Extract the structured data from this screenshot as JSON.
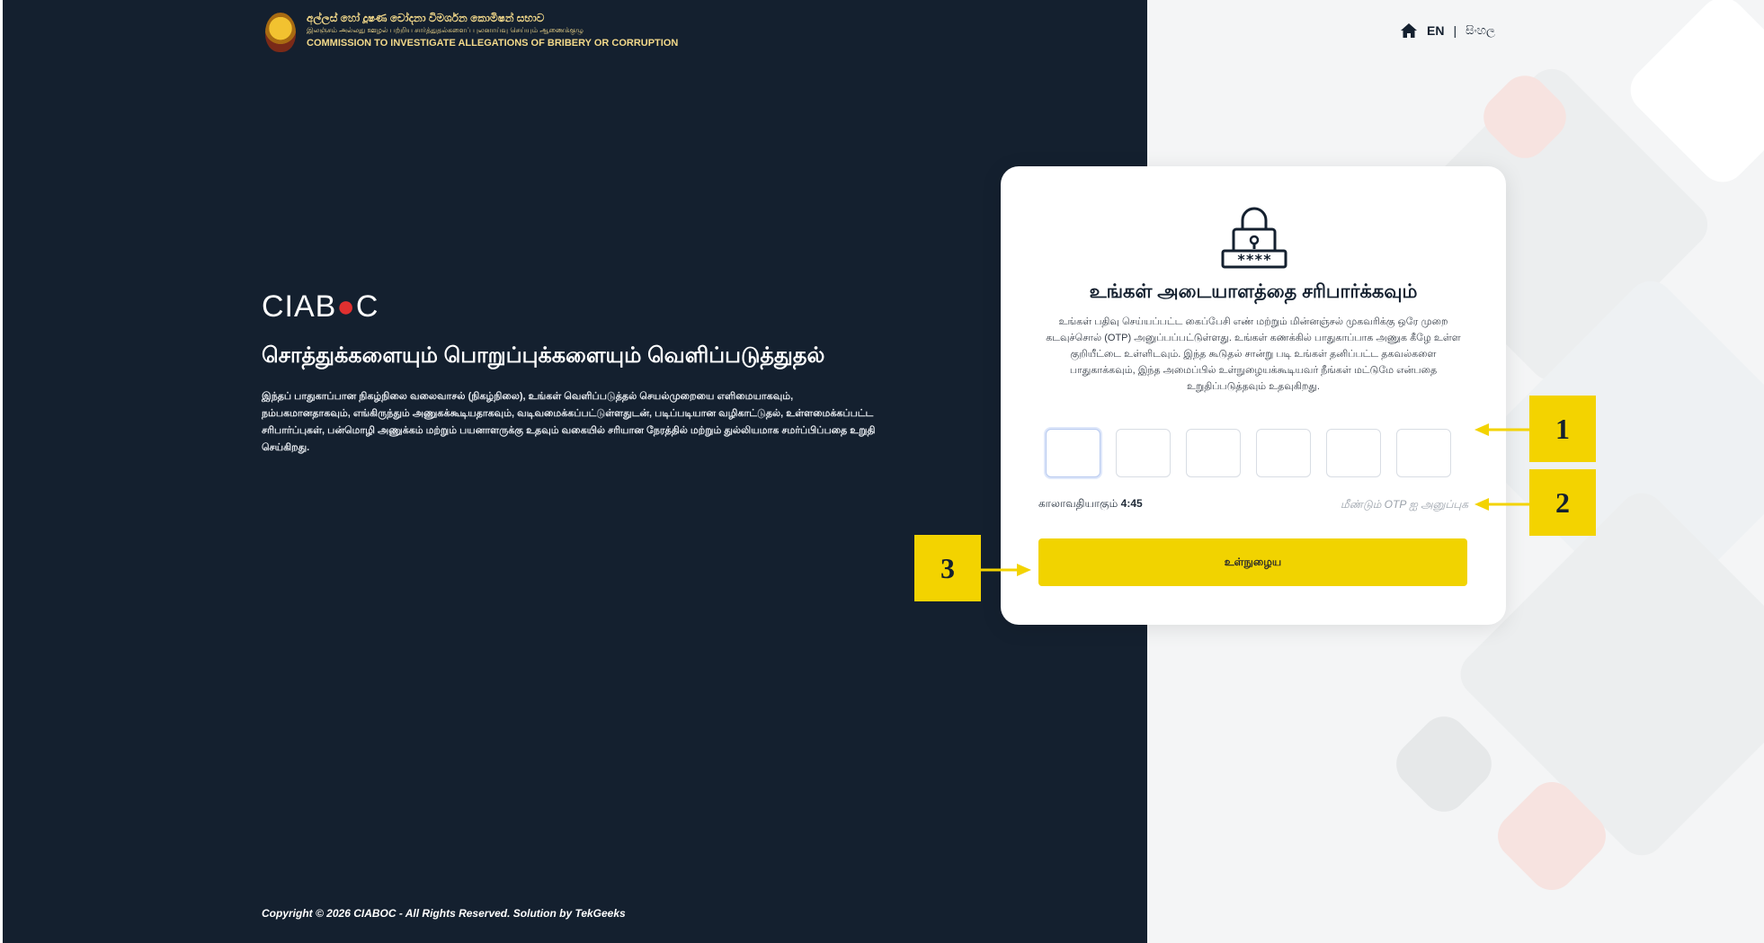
{
  "header": {
    "org_sinhala": "අල්ලස් හෝ දූෂණ චෝදනා විමර්ශන කොමිෂන් සභාව",
    "org_tamil": "இலஞ்சம் அல்லது ஊழல் பற்றிய சார்த்துதல்களைப் புலனாய்வு செய்யும் ஆணைக்குழு",
    "org_english": "COMMISSION TO INVESTIGATE ALLEGATIONS OF BRIBERY OR CORRUPTION"
  },
  "brand": {
    "logo_prefix": "CIAB",
    "logo_dot": "●",
    "logo_suffix": "C",
    "title": "சொத்துக்களையும் பொறுப்புக்களையும் வெளிப்படுத்துதல்",
    "description": "இந்தப் பாதுகாப்பான நிகழ்நிலை வலைவாசல் (நிகழ்நிலை), உங்கள் வெளிப்படுத்தல் செயல்முறையை எளிமையாகவும், நம்பகமானதாகவும், எங்கிருந்தும் அணுகக்கூடியதாகவும், வடிவமைக்கப்பட்டுள்ளதுடன், படிப்படியான வழிகாட்டுதல், உள்ளமைக்கப்பட்ட சரிபார்ப்புகள், பன்மொழி அணுக்கம் மற்றும் பயனாளருக்கு உதவும் வகையில் சரியான நேரத்தில் மற்றும் துல்லியமாக சமர்ப்பிப்பதை உறுதி செய்கிறது."
  },
  "footer": {
    "copyright": "Copyright © 2026 CIABOC - All Rights Reserved. Solution by TekGeeks"
  },
  "nav": {
    "home_icon": "home-icon",
    "lang_en": "EN",
    "separator": "|",
    "lang_si": "සිංහල"
  },
  "card": {
    "icon": "lock-password-icon",
    "title": "உங்கள் அடையாளத்தை சரிபார்க்கவும்",
    "description": "உங்கள் பதிவு செய்யப்பட்ட கைப்பேசி எண் மற்றும் மின்னஞ்சல் முகவரிக்கு ஒரே முறை கடவுச்சொல் (OTP) அனுப்பப்பட்டுள்ளது. உங்கள் கணக்கில் பாதுகாப்பாக அணுக கீழே உள்ள குறியீட்டை உள்ளிடவும். இந்த கூடுதல் சான்று படி உங்கள் தனிப்பட்ட தகவல்களை பாதுகாக்கவும், இந்த அமைப்பில் உள்நுழையக்கூடியவர் நீங்கள் மட்டுமே என்பதை உறுதிப்படுத்தவும் உதவுகிறது.",
    "otp_digits": [
      "",
      "",
      "",
      "",
      "",
      ""
    ],
    "timer_label": "காலாவதியாகும்",
    "timer_value": "4:45",
    "resend_label": "மீண்டும் OTP ஐ அனுப்புக",
    "submit_label": "உள்நுழைய"
  },
  "callouts": [
    "1",
    "2",
    "3"
  ],
  "colors": {
    "left_bg": "#14202f",
    "accent_yellow": "#f1d300",
    "callout_yellow": "#f3d300",
    "logo_red": "#e03030"
  }
}
